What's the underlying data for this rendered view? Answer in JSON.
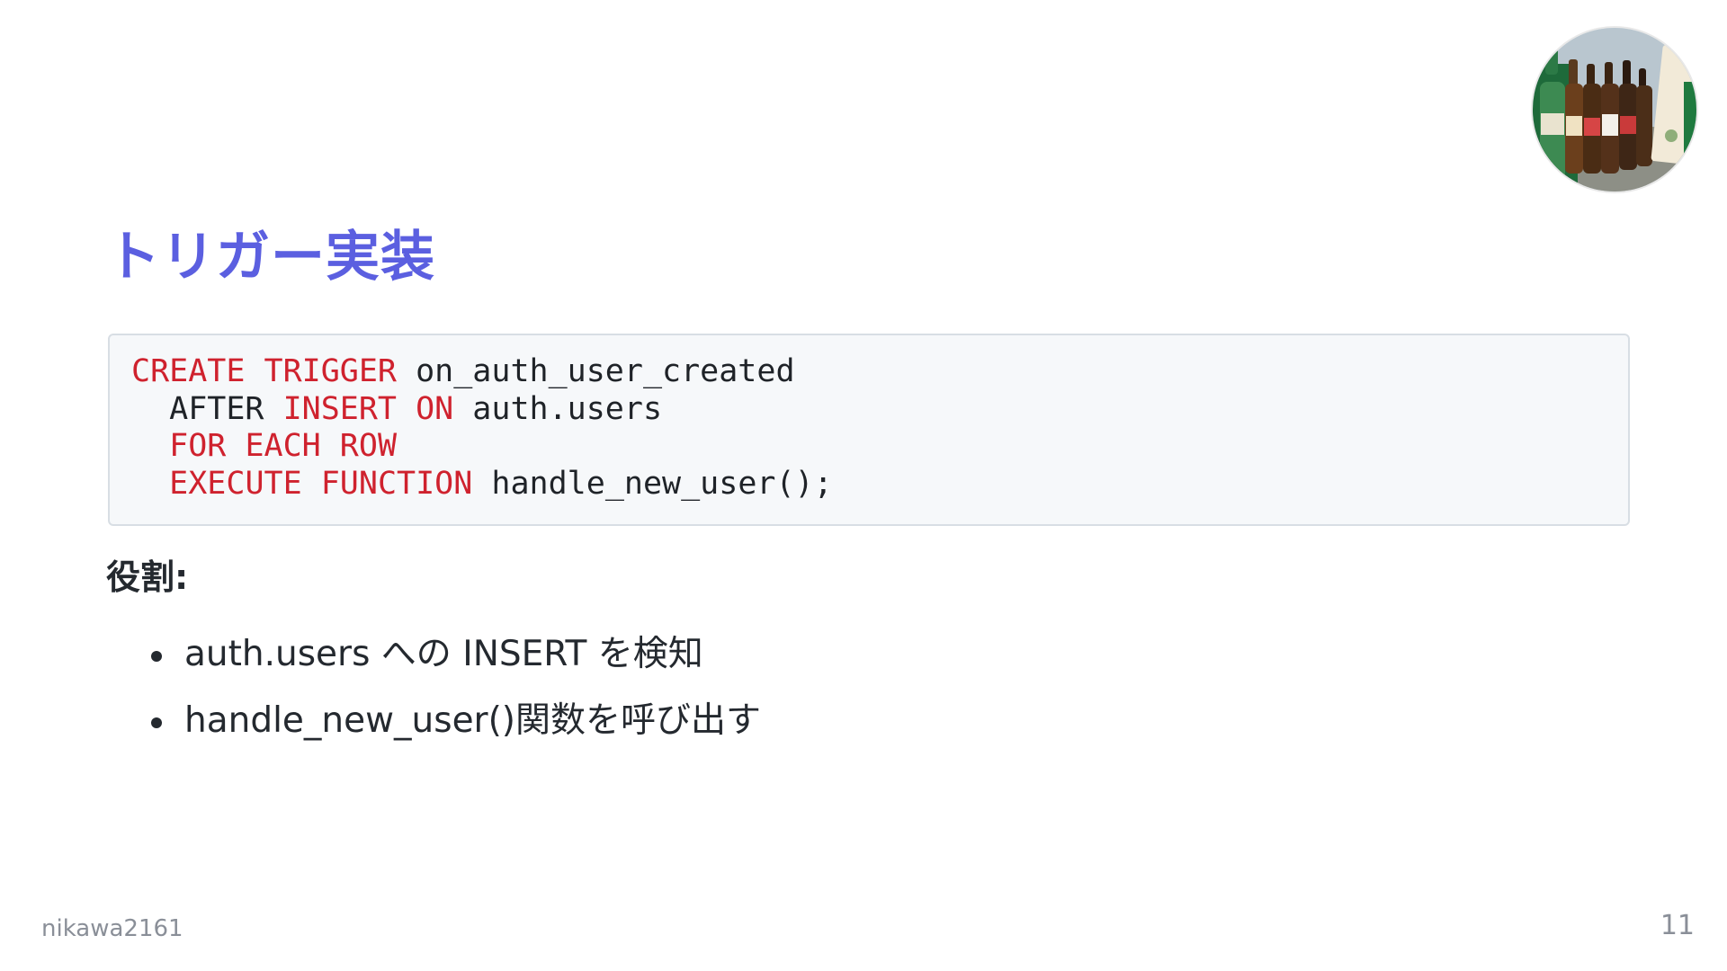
{
  "slide": {
    "title": "トリガー実装",
    "code_lines": [
      [
        {
          "text": "CREATE TRIGGER",
          "kw": true
        },
        {
          "text": " on_auth_user_created",
          "kw": false
        }
      ],
      [
        {
          "text": "  AFTER ",
          "kw": false
        },
        {
          "text": "INSERT ON",
          "kw": true
        },
        {
          "text": " auth.users",
          "kw": false
        }
      ],
      [
        {
          "text": "  ",
          "kw": false
        },
        {
          "text": "FOR EACH ROW",
          "kw": true
        }
      ],
      [
        {
          "text": "  ",
          "kw": false
        },
        {
          "text": "EXECUTE FUNCTION",
          "kw": true
        },
        {
          "text": " handle_new_user();",
          "kw": false
        }
      ]
    ],
    "role_label": "役割:",
    "bullets": [
      "auth.users への INSERT を検知",
      "handle_new_user()関数を呼び出す"
    ]
  },
  "footer": {
    "author": "nikawa2161",
    "page_number": "11"
  },
  "colors": {
    "title": "#5b5fe0",
    "keyword": "#cf222e",
    "code_background": "#f6f8fa",
    "muted": "#8a8f98"
  },
  "avatar": {
    "icon": "avatar-photo-bottles"
  }
}
